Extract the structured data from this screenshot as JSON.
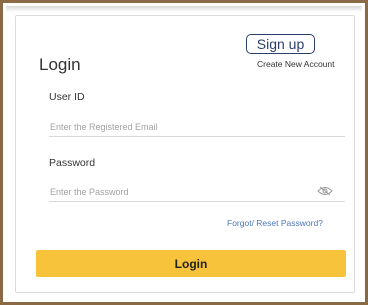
{
  "login_form": {
    "title": "Login",
    "signup": {
      "label": "Sign up",
      "caption": "Create New Account"
    },
    "user_id": {
      "label": "User ID",
      "placeholder": "Enter the Registered Email",
      "value": ""
    },
    "password": {
      "label": "Password",
      "placeholder": "Enter the Password",
      "value": "",
      "toggle_icon": "eye-icon"
    },
    "forgot_link": "Forgot/ Reset Password?",
    "submit_label": "Login"
  },
  "colors": {
    "frame": "#8a6a44",
    "accent": "#f7c33b",
    "signup_border": "#2c3e6b",
    "link": "#4a78b8"
  }
}
